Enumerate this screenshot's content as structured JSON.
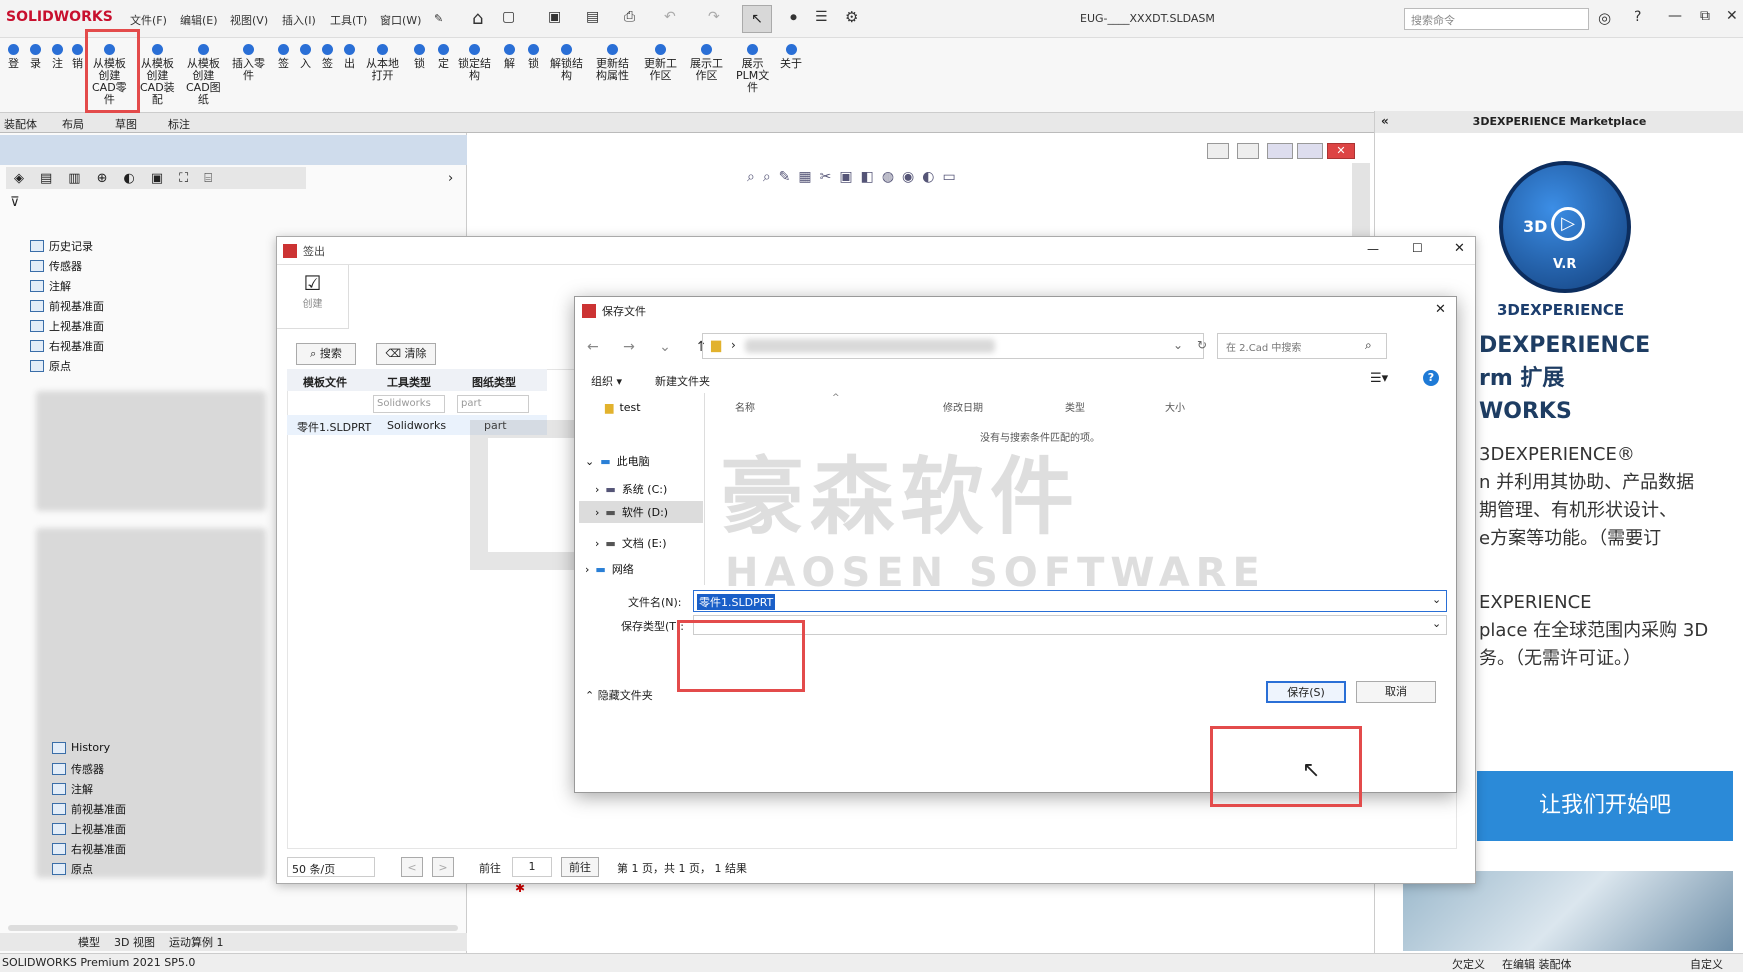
{
  "app": {
    "logo": "SOLIDWORKS",
    "title": "EUG-____XXXDT.SLDASM",
    "status": "SOLIDWORKS Premium 2021 SP5.0",
    "status_right": [
      "欠定义",
      "在编辑 装配体",
      "自定义"
    ]
  },
  "menu": [
    "文件(F)",
    "编辑(E)",
    "视图(V)",
    "插入(I)",
    "工具(T)",
    "窗口(W)"
  ],
  "cmd_search_placeholder": "搜索命令",
  "ribbon": [
    {
      "label": "登"
    },
    {
      "label": "录"
    },
    {
      "label": "注"
    },
    {
      "label": "销"
    },
    {
      "label": "从模板\n创建\nCAD零\n件",
      "highlight": true
    },
    {
      "label": "从模板\n创建\nCAD装\n配"
    },
    {
      "label": "从模板\n创建\nCAD图\n纸"
    },
    {
      "label": "插入零\n件"
    },
    {
      "label": "签"
    },
    {
      "label": "入"
    },
    {
      "label": "签"
    },
    {
      "label": "出"
    },
    {
      "label": "从本地\n打开"
    },
    {
      "label": "锁"
    },
    {
      "label": "定"
    },
    {
      "label": "锁定结\n构"
    },
    {
      "label": "解"
    },
    {
      "label": "锁"
    },
    {
      "label": "解锁结\n构"
    },
    {
      "label": "更新结\n构属性"
    },
    {
      "label": "更新工\n作区"
    },
    {
      "label": "展示工\n作区"
    },
    {
      "label": "展示\nPLM文\n件"
    },
    {
      "label": "关于"
    }
  ],
  "ribbon_tabs": [
    "装配体",
    "布局",
    "草图",
    "标注"
  ],
  "tree": {
    "top": [
      "历史记录",
      "传感器",
      "注解",
      "前视基准面",
      "上视基准面",
      "右视基准面",
      "原点"
    ],
    "bottom": [
      "History",
      "传感器",
      "注解",
      "前视基准面",
      "上视基准面",
      "右视基准面",
      "原点"
    ]
  },
  "bottom_tabs": [
    "模型",
    "3D 视图",
    "运动算例 1"
  ],
  "marketplace": {
    "header": "3DEXPERIENCE Marketplace",
    "brand": "3DEXPERIENCE",
    "logo_texts": [
      "3D",
      "V",
      "R"
    ],
    "heading": [
      "DEXPERIENCE",
      "rm 扩展",
      "WORKS"
    ],
    "para1": [
      "3DEXPERIENCE®",
      "n 并利用其协助、产品数据",
      "期管理、有机形状设计、",
      "e方案等功能。（需要订"
    ],
    "para2": [
      "EXPERIENCE",
      "place 在全球范围内采购 3D",
      "务。（无需许可证。）"
    ],
    "cta": "让我们开始吧"
  },
  "checkout": {
    "title": "签出",
    "create": "创建",
    "search_btn": "搜索",
    "clear_btn": "清除",
    "columns": [
      "模板文件",
      "工具类型",
      "图纸类型"
    ],
    "filter_tool": "Solidworks",
    "filter_drawing": "part",
    "row": [
      "零件1.SLDPRT",
      "Solidworks",
      "part"
    ],
    "page_size": "50 条/页",
    "goto": "前往",
    "page_input": "1",
    "goto_btn": "前往",
    "summary": "第 1 页，共 1 页，  1 结果"
  },
  "save": {
    "title": "保存文件",
    "search_placeholder": "在 2.Cad 中搜索",
    "organize": "组织",
    "new_folder": "新建文件夹",
    "nav": [
      "test",
      "此电脑",
      "系统 (C:)",
      "软件 (D:)",
      "文档 (E:)",
      "网络"
    ],
    "cols": [
      "名称",
      "修改日期",
      "类型",
      "大小"
    ],
    "empty": "没有与搜索条件匹配的项。",
    "filename_label": "文件名(N):",
    "filename": "零件1.SLDPRT",
    "filetype_label": "保存类型(T):",
    "hide_folders": "隐藏文件夹",
    "save_btn": "保存(S)",
    "cancel_btn": "取消"
  },
  "watermark": {
    "cn": "豪森软件",
    "en": "HAOSEN SOFTWARE"
  },
  "colors": {
    "accent": "#2a6fd6",
    "highlight": "#e34b4b",
    "cta": "#2b8ad8",
    "brand": "#c8102e"
  }
}
